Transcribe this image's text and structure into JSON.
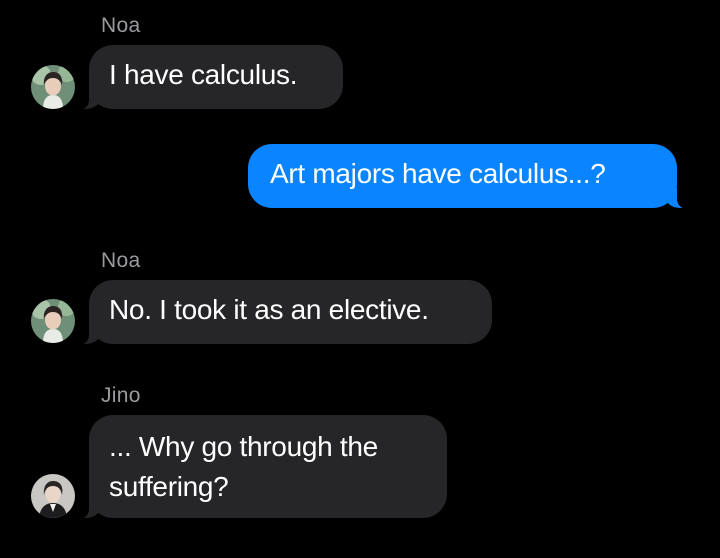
{
  "conversation": {
    "messages": [
      {
        "sender": "Noa",
        "direction": "incoming",
        "text": "I have calculus.",
        "avatar_icon": "noa-avatar-icon"
      },
      {
        "sender": "",
        "direction": "outgoing",
        "text": "Art majors have calculus...?"
      },
      {
        "sender": "Noa",
        "direction": "incoming",
        "text": "No. I took it as an elective.",
        "avatar_icon": "noa-avatar-icon"
      },
      {
        "sender": "Jino",
        "direction": "incoming",
        "text": "... Why go through the suffering?",
        "avatar_icon": "jino-avatar-icon"
      }
    ]
  },
  "colors": {
    "background": "#000000",
    "incoming_bubble": "#262629",
    "outgoing_bubble": "#0a84ff",
    "sender_name": "#9a9a9f",
    "text": "#ffffff"
  }
}
